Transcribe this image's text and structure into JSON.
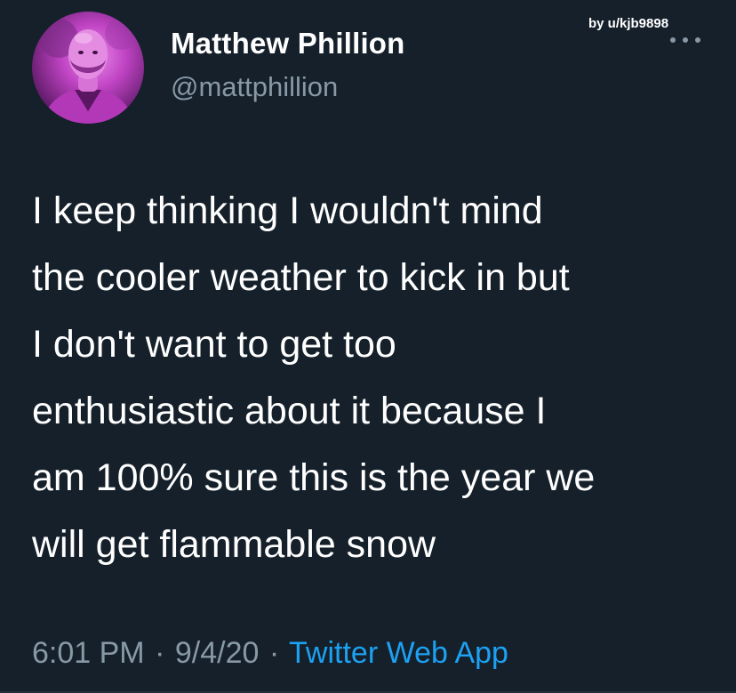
{
  "author": {
    "name": "Matthew Phillion",
    "handle": "@mattphillion"
  },
  "watermark": "by u/kjb9898",
  "tweet": {
    "lines": [
      "I keep thinking I wouldn't mind",
      "the cooler weather to kick in but",
      "I don't want to get too",
      "enthusiastic about it because I",
      "am 100% sure this is the year we",
      "will get flammable snow"
    ],
    "time": "6:01 PM",
    "date": "9/4/20",
    "separator": "·",
    "source": "Twitter Web App"
  },
  "icons": {
    "more": "more-options-icon",
    "avatar": "profile-photo"
  },
  "colors": {
    "background": "#15202b",
    "text": "#ffffff",
    "muted": "#8899a6",
    "link": "#1da1f2",
    "avatar_tint": "#c044c4"
  }
}
